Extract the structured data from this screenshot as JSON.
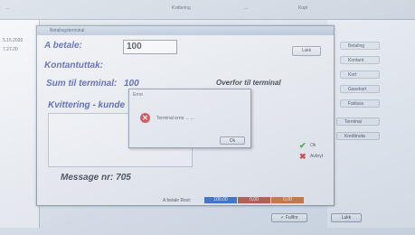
{
  "window": {
    "top_tabs": [
      "...",
      "Kvittering",
      "...",
      "Kopi"
    ],
    "left_times": [
      "5.15.2020",
      "7.27.20"
    ]
  },
  "dialog": {
    "title": "Betalingsterminal",
    "a_betale_label": "A betale:",
    "a_betale_value": "100",
    "kontantuttak_label": "Kontantuttak:",
    "sum_terminal_label": "Sum til terminal:",
    "sum_terminal_value": "100",
    "overfor_label": "Overfor til terminal",
    "kvittering_label": "Kvittering - kunde",
    "message_label": "Message nr: 705",
    "lukk_button": "Lukk",
    "ok_button": "Ok",
    "avbryt_button": "Avbryt"
  },
  "error_popup": {
    "title": "Error",
    "text": "Terminal error ... ...",
    "ok_button": "Ok"
  },
  "bottom": {
    "a_betale_rest_label": "A betale Rest:",
    "bar_value_blue": "100,00",
    "bar_value_red": "0,00",
    "bar_value_orange": "0,00",
    "fullfor_button": "Fullfor",
    "lukk_button": "Lukk"
  },
  "right_panel": {
    "items": [
      "Betaling",
      "Kontant",
      "Kort",
      "Gavekort",
      "Faktura",
      "Terminal",
      "Kreditnota"
    ]
  },
  "colors": {
    "label_blue": "#2d3f9e",
    "bar_blue": "#1f5fc6",
    "bar_red": "#b8432c",
    "bar_orange": "#d2661f",
    "error_red": "#d42a2a"
  }
}
